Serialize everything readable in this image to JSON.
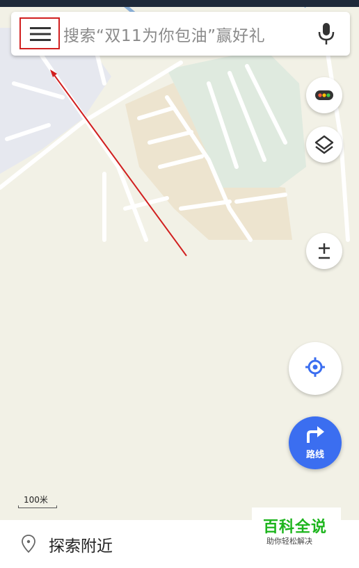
{
  "search": {
    "placeholder": "搜索“双11为你包油”赢好礼"
  },
  "icons": {
    "menu": "menu-icon",
    "mic": "microphone-icon",
    "traffic": "traffic-icon",
    "layers": "layers-icon",
    "zoom": "zoom-icon",
    "locate": "locate-icon",
    "route": "route-arrow-icon",
    "explore": "location-pin-icon"
  },
  "zoom": {
    "label": "±"
  },
  "route": {
    "label": "路线"
  },
  "scale": {
    "label": "100米"
  },
  "explore": {
    "label": "探索附近"
  },
  "watermark": {
    "title": "百科全说",
    "subtitle": "助你轻松解决"
  },
  "colors": {
    "accent": "#3b6ef0",
    "annotation": "#d11f1f",
    "watermark": "#1db51d",
    "map_background": "#f2f1e6"
  }
}
